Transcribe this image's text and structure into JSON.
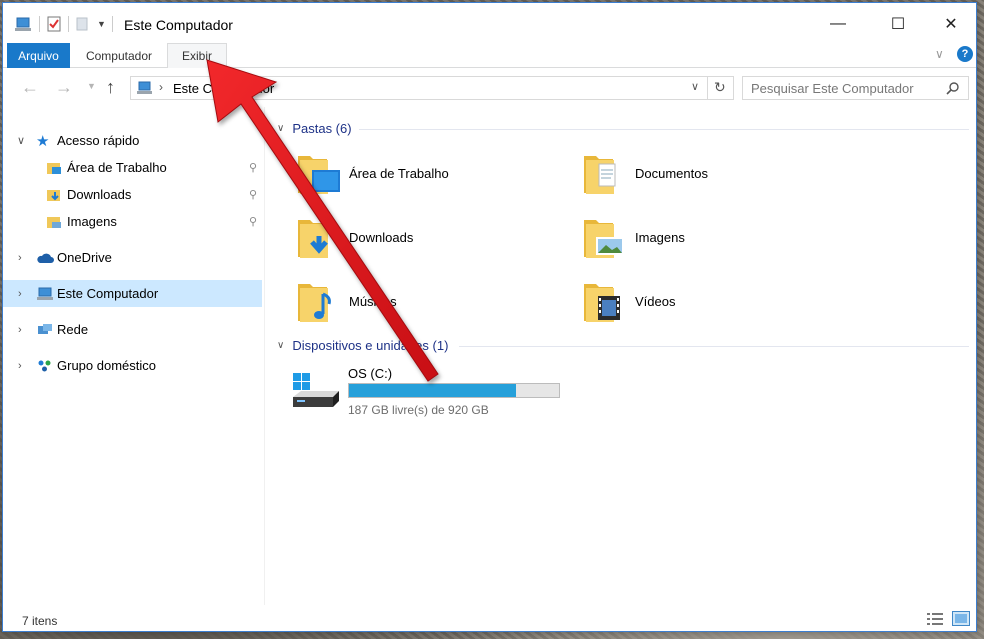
{
  "window": {
    "title": "Este Computador",
    "controls": {
      "minimize": "—",
      "maximize": "☐",
      "close": "✕"
    }
  },
  "ribbon": {
    "tabs": [
      {
        "label": "Arquivo"
      },
      {
        "label": "Computador"
      },
      {
        "label": "Exibir"
      }
    ],
    "help": "?"
  },
  "address_bar": {
    "path": "Este Computador",
    "search_placeholder": "Pesquisar Este Computador"
  },
  "nav": {
    "quick_access": "Acesso rápido",
    "quick_items": [
      {
        "label": "Área de Trabalho"
      },
      {
        "label": "Downloads"
      },
      {
        "label": "Imagens"
      }
    ],
    "onedrive": "OneDrive",
    "this_pc": "Este Computador",
    "network": "Rede",
    "homegroup": "Grupo doméstico"
  },
  "content": {
    "folders_header": "Pastas (6)",
    "folders": [
      {
        "label": "Área de Trabalho",
        "icon": "desktop-folder-icon"
      },
      {
        "label": "Documentos",
        "icon": "documents-folder-icon"
      },
      {
        "label": "Downloads",
        "icon": "downloads-folder-icon"
      },
      {
        "label": "Imagens",
        "icon": "pictures-folder-icon"
      },
      {
        "label": "Músicas",
        "icon": "music-folder-icon"
      },
      {
        "label": "Vídeos",
        "icon": "videos-folder-icon"
      }
    ],
    "devices_header": "Dispositivos e unidades (1)",
    "drive": {
      "name": "OS (C:)",
      "free_text": "187 GB livre(s) de 920 GB",
      "used_fraction": 0.797
    }
  },
  "status": {
    "items": "7 itens"
  },
  "colors": {
    "accent": "#1979ca",
    "selection": "#cce8ff",
    "drive_bar": "#26a0da",
    "annotation_arrow": "#e0151a"
  }
}
